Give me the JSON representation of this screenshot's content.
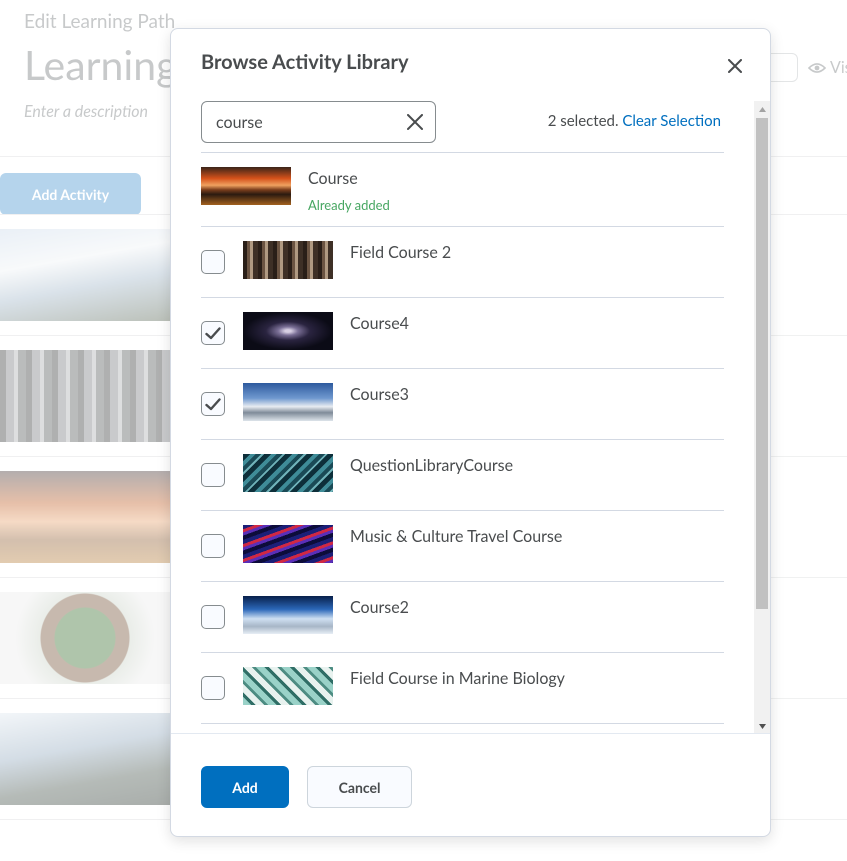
{
  "background": {
    "breadcrumb": "Edit Learning Path",
    "title": "Learning",
    "description_placeholder": "Enter a description",
    "visibility_label": "Vis",
    "add_activity_label": "Add Activity"
  },
  "dialog": {
    "title": "Browse Activity Library",
    "search": {
      "value": "course"
    },
    "selection_status": "2 selected.",
    "clear_selection_label": "Clear Selection",
    "items": [
      {
        "name": "Course",
        "status": "Already added",
        "thumbnail": "sunset-field"
      },
      {
        "name": "Field Course 2",
        "checked": false,
        "thumbnail": "forest"
      },
      {
        "name": "Course4",
        "checked": true,
        "thumbnail": "galaxy"
      },
      {
        "name": "Course3",
        "checked": true,
        "thumbnail": "snowy-mountains"
      },
      {
        "name": "QuestionLibraryCourse",
        "checked": false,
        "thumbnail": "teal-rope"
      },
      {
        "name": "Music & Culture Travel Course",
        "checked": false,
        "thumbnail": "colorful-strands"
      },
      {
        "name": "Course2",
        "checked": false,
        "thumbnail": "earth-horizon"
      },
      {
        "name": "Field Course in Marine Biology",
        "checked": false,
        "thumbnail": "teal-pattern"
      }
    ],
    "add_label": "Add",
    "cancel_label": "Cancel"
  },
  "colors": {
    "primary": "#006fbf",
    "success_text": "#46a661",
    "text": "#494c4e",
    "border": "#d3d9e3"
  }
}
